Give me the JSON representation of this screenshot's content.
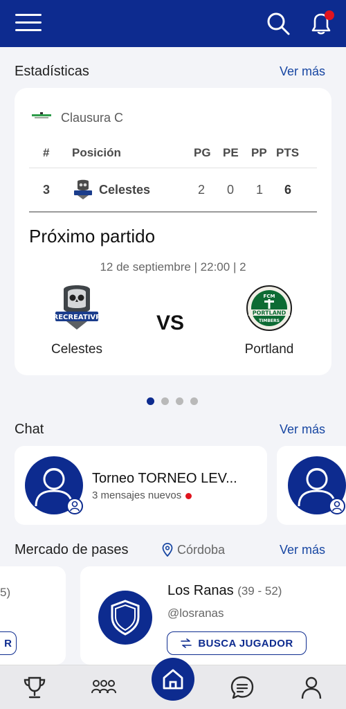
{
  "header": {
    "icons": [
      "menu-icon",
      "search-icon",
      "bell-icon"
    ],
    "notification_dot_color": "#e0141e"
  },
  "stats": {
    "title": "Estadísticas",
    "ver_mas": "Ver más",
    "league": "Clausura C",
    "headers": {
      "rank": "#",
      "position": "Posición",
      "pg": "PG",
      "pe": "PE",
      "pp": "PP",
      "pts": "PTS"
    },
    "row": {
      "rank": "3",
      "team": "Celestes",
      "pg": "2",
      "pe": "0",
      "pp": "1",
      "pts": "6"
    }
  },
  "next_match": {
    "title": "Próximo partido",
    "info": "12 de septiembre | 22:00 | 2",
    "home": {
      "name": "Celestes",
      "logo_text": "RECREATIVP"
    },
    "vs": "VS",
    "away": {
      "name": "Portland",
      "logo_text": "PORTLAND",
      "logo_subtext": "TIMBERS",
      "logo_top": "FCM"
    }
  },
  "carousel": {
    "pages": 4,
    "active": 1
  },
  "chat": {
    "title": "Chat",
    "ver_mas": "Ver más",
    "item": {
      "title": "Torneo TORNEO LEV...",
      "subtitle": "3 mensajes nuevos"
    }
  },
  "market": {
    "title": "Mercado de pases",
    "location": "Córdoba",
    "ver_mas": "Ver más",
    "left_fragment": "5)",
    "left_button_fragment": "R",
    "team": {
      "name": "Los Ranas",
      "age_range": "(39 - 52)",
      "handle": "@losranas",
      "button": "BUSCA JUGADOR"
    }
  },
  "bottom_nav": [
    "trophy-icon",
    "team-icon",
    "home-icon",
    "chat-icon",
    "profile-icon"
  ],
  "colors": {
    "primary": "#0d2b8f",
    "link": "#1746a2",
    "background": "#f3f4f8"
  }
}
